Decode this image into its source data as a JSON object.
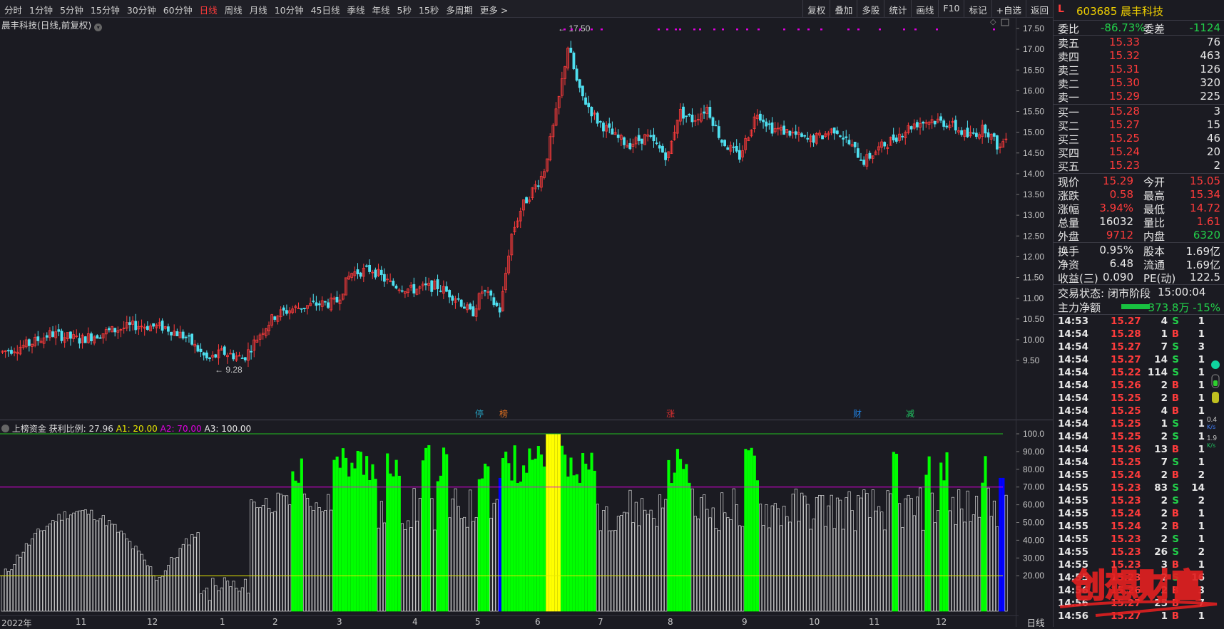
{
  "toolbar": {
    "periods": [
      "分时",
      "1分钟",
      "5分钟",
      "15分钟",
      "30分钟",
      "60分钟",
      "日线",
      "周线",
      "月线",
      "10分钟",
      "45日线",
      "季线",
      "年线",
      "5秒",
      "15秒",
      "多周期",
      "更多 >"
    ],
    "active_period": "日线",
    "buttons": [
      "复权",
      "叠加",
      "多股",
      "统计",
      "画线",
      "F10",
      "标记",
      "+自选",
      "返回"
    ]
  },
  "chart": {
    "title": "晨丰科技(日线,前复权)",
    "high_label": "17.50",
    "low_label": "9.28",
    "price_ticks": [
      "17.50",
      "17.00",
      "16.50",
      "16.00",
      "15.50",
      "15.00",
      "14.50",
      "14.00",
      "13.50",
      "13.00",
      "12.50",
      "12.00",
      "11.50",
      "11.00",
      "10.50",
      "10.00",
      "9.50"
    ],
    "event_tags": [
      "停",
      "榜",
      "涨",
      "财",
      "减"
    ]
  },
  "indicator": {
    "name": "上榜资金",
    "ratio_label": "获利比例: 27.96",
    "a1": "A1: 20.00",
    "a2": "A2: 70.00",
    "a3": "A3: 100.00",
    "ticks": [
      "100.0",
      "90.00",
      "80.00",
      "70.00",
      "60.00",
      "50.00",
      "40.00",
      "30.00",
      "20.00"
    ]
  },
  "x_axis": {
    "labels": [
      "2022年",
      "11",
      "12",
      "1",
      "2",
      "3",
      "4",
      "5",
      "6",
      "7",
      "8",
      "9",
      "10",
      "11",
      "12"
    ],
    "mode_label": "日线"
  },
  "colors": {
    "up": "#ff3b3b",
    "down": "#4fe0f0",
    "bright_green": "#00ff00",
    "yellow": "#ffff00",
    "blue": "#0000ff",
    "magenta": "#e000e0"
  },
  "quote": {
    "market_flag": "L",
    "code": "603685",
    "name": "晨丰科技",
    "weibi_label": "委比",
    "weibi": "-86.73%",
    "weicha_label": "委差",
    "weicha": "-1124",
    "asks": [
      {
        "label": "卖五",
        "price": "15.33",
        "vol": "76"
      },
      {
        "label": "卖四",
        "price": "15.32",
        "vol": "463"
      },
      {
        "label": "卖三",
        "price": "15.31",
        "vol": "126"
      },
      {
        "label": "卖二",
        "price": "15.30",
        "vol": "320"
      },
      {
        "label": "卖一",
        "price": "15.29",
        "vol": "225"
      }
    ],
    "bids": [
      {
        "label": "买一",
        "price": "15.28",
        "vol": "3"
      },
      {
        "label": "买二",
        "price": "15.27",
        "vol": "15"
      },
      {
        "label": "买三",
        "price": "15.25",
        "vol": "46"
      },
      {
        "label": "买四",
        "price": "15.24",
        "vol": "20"
      },
      {
        "label": "买五",
        "price": "15.23",
        "vol": "2"
      }
    ],
    "stats": [
      {
        "l1": "现价",
        "v1": "15.29",
        "c1": "red",
        "l2": "今开",
        "v2": "15.05",
        "c2": "red"
      },
      {
        "l1": "涨跌",
        "v1": "0.58",
        "c1": "red",
        "l2": "最高",
        "v2": "15.34",
        "c2": "red"
      },
      {
        "l1": "涨幅",
        "v1": "3.94%",
        "c1": "red",
        "l2": "最低",
        "v2": "14.72",
        "c2": "red"
      },
      {
        "l1": "总量",
        "v1": "16032",
        "c1": "white",
        "l2": "量比",
        "v2": "1.61",
        "c2": "red"
      },
      {
        "l1": "外盘",
        "v1": "9712",
        "c1": "red",
        "l2": "内盘",
        "v2": "6320",
        "c2": "green"
      }
    ],
    "stats2": [
      {
        "l1": "换手",
        "v1": "0.95%",
        "l2": "股本",
        "v2": "1.69亿"
      },
      {
        "l1": "净资",
        "v1": "6.48",
        "l2": "流通",
        "v2": "1.69亿"
      },
      {
        "l1": "收益(三)",
        "v1": "0.090",
        "l2": "PE(动)",
        "v2": "122.5"
      }
    ],
    "trade_status_label": "交易状态:",
    "trade_status": "闭市阶段",
    "trade_time": "15:00:04",
    "main_flow_label": "主力净额",
    "main_flow_value": "-373.8万",
    "main_flow_pct": "-15%"
  },
  "ticks": [
    {
      "t": "14:53",
      "p": "15.27",
      "v": "4",
      "s": "S",
      "n": "1"
    },
    {
      "t": "14:54",
      "p": "15.28",
      "v": "1",
      "s": "B",
      "n": "1"
    },
    {
      "t": "14:54",
      "p": "15.27",
      "v": "7",
      "s": "S",
      "n": "3"
    },
    {
      "t": "14:54",
      "p": "15.27",
      "v": "14",
      "s": "S",
      "n": "1"
    },
    {
      "t": "14:54",
      "p": "15.22",
      "v": "114",
      "s": "S",
      "n": "1"
    },
    {
      "t": "14:54",
      "p": "15.26",
      "v": "2",
      "s": "B",
      "n": "1"
    },
    {
      "t": "14:54",
      "p": "15.25",
      "v": "2",
      "s": "B",
      "n": "1"
    },
    {
      "t": "14:54",
      "p": "15.25",
      "v": "4",
      "s": "B",
      "n": "1"
    },
    {
      "t": "14:54",
      "p": "15.25",
      "v": "1",
      "s": "S",
      "n": "1"
    },
    {
      "t": "14:54",
      "p": "15.25",
      "v": "2",
      "s": "S",
      "n": "1"
    },
    {
      "t": "14:54",
      "p": "15.26",
      "v": "13",
      "s": "B",
      "n": "1"
    },
    {
      "t": "14:54",
      "p": "15.25",
      "v": "7",
      "s": "S",
      "n": "1"
    },
    {
      "t": "14:55",
      "p": "15.24",
      "v": "2",
      "s": "B",
      "n": "2"
    },
    {
      "t": "14:55",
      "p": "15.23",
      "v": "83",
      "s": "S",
      "n": "14"
    },
    {
      "t": "14:55",
      "p": "15.23",
      "v": "2",
      "s": "S",
      "n": "2"
    },
    {
      "t": "14:55",
      "p": "15.24",
      "v": "2",
      "s": "B",
      "n": "1"
    },
    {
      "t": "14:55",
      "p": "15.24",
      "v": "2",
      "s": "B",
      "n": "1"
    },
    {
      "t": "14:55",
      "p": "15.23",
      "v": "2",
      "s": "S",
      "n": "1"
    },
    {
      "t": "14:55",
      "p": "15.23",
      "v": "26",
      "s": "S",
      "n": "2"
    },
    {
      "t": "14:55",
      "p": "15.23",
      "v": "3",
      "s": "B",
      "n": "1"
    },
    {
      "t": "14:55",
      "p": "15.23",
      "v": "2",
      "s": "S",
      "n": "16"
    },
    {
      "t": "14:56",
      "p": "15.26",
      "v": "2",
      "s": "B",
      "n": "3"
    },
    {
      "t": "14:56",
      "p": "15.27",
      "v": "25",
      "s": "B",
      "n": "7"
    },
    {
      "t": "14:56",
      "p": "15.27",
      "v": "1",
      "s": "B",
      "n": "1"
    }
  ],
  "side": {
    "speed1": "0.4",
    "unit1": "K/s",
    "speed2": "1.9",
    "unit2": "K/s"
  },
  "watermark": {
    "text": "创想财富"
  }
}
